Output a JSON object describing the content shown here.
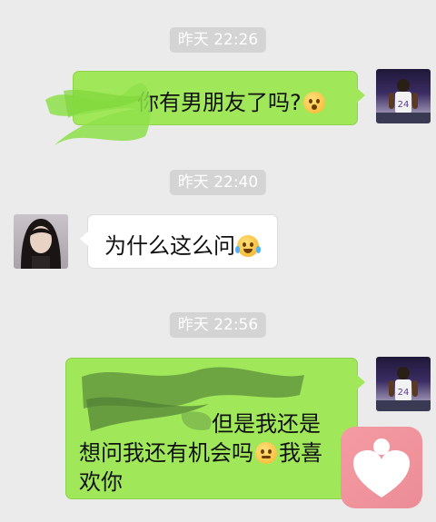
{
  "timestamps": [
    "昨天 22:26",
    "昨天 22:40",
    "昨天 22:56"
  ],
  "messages": [
    {
      "side": "sent",
      "prefix": "",
      "text": "你有男朋友了吗?",
      "emoji": "surprised-face-icon"
    },
    {
      "side": "received",
      "text": "为什么这么问",
      "emoji": "tears-of-joy-icon"
    },
    {
      "side": "sent",
      "line1": "但是我还是",
      "line2_a": "想问我还有机会吗",
      "line2_b": "我喜",
      "line3": "欢你",
      "emoji": "confounded-face-icon"
    }
  ],
  "colors": {
    "background": "#ebebeb",
    "sent_bubble": "#a0e759",
    "received_bubble": "#ffffff",
    "timestamp_bg": "#d4d4d4",
    "logo": "#ef919b"
  },
  "icons": {
    "sender_avatar": "basketball-player-avatar",
    "receiver_avatar": "girl-avatar",
    "watermark_logo": "heart-logo"
  }
}
